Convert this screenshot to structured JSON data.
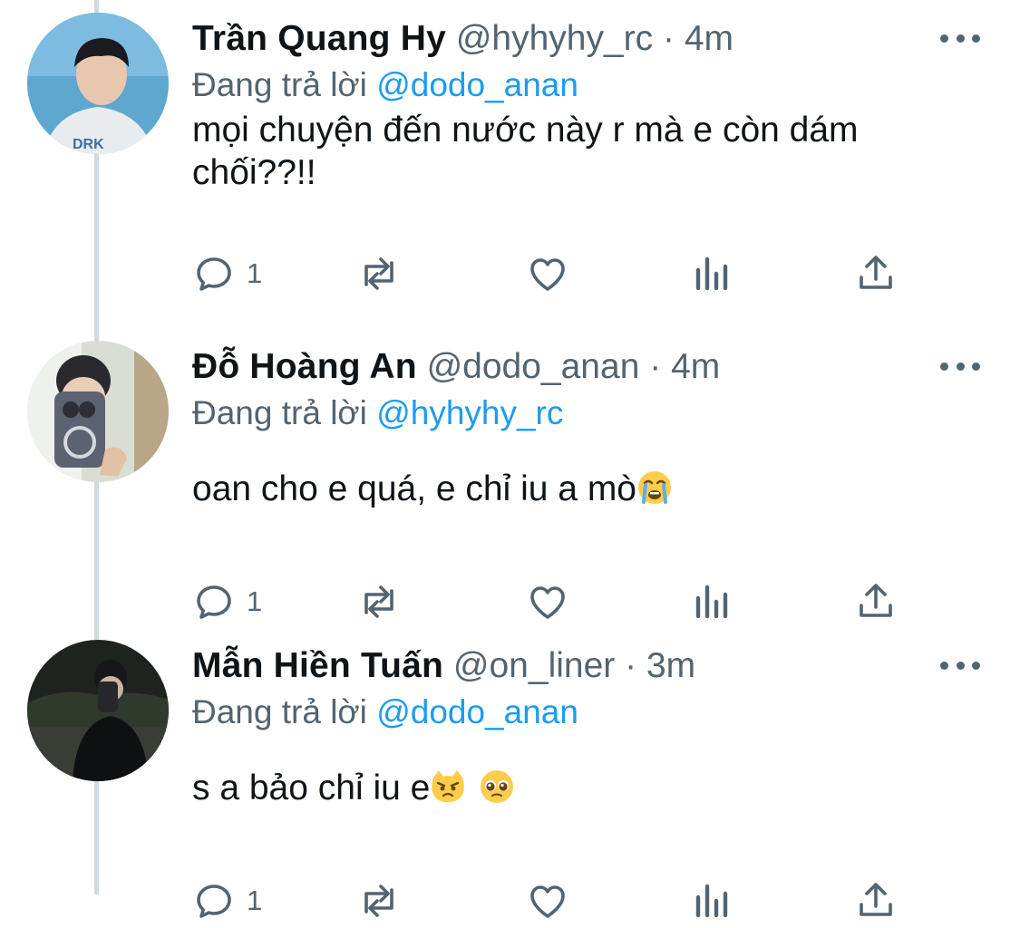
{
  "replies": [
    {
      "name": "Trần Quang Hy",
      "handle": "@hyhyhy_rc",
      "separator": "·",
      "time": "4m",
      "replying_prefix": "Đang trả lời",
      "replying_to": "@dodo_anan",
      "text": "mọi chuyện đến nước này r mà e còn dám chối??!!",
      "emojis": [],
      "reply_count": "1",
      "avatar_icon": "person-photo-avatar"
    },
    {
      "name": "Đỗ Hoàng An",
      "handle": "@dodo_anan",
      "separator": "·",
      "time": "4m",
      "replying_prefix": "Đang trả lời",
      "replying_to": "@hyhyhy_rc",
      "text": "oan cho e quá, e chỉ iu a mò",
      "emojis": [
        "loudly-crying-face"
      ],
      "reply_count": "1",
      "avatar_icon": "mirror-selfie-avatar"
    },
    {
      "name": "Mẫn Hiền Tuấn",
      "handle": "@on_liner",
      "separator": "·",
      "time": "3m",
      "replying_prefix": "Đang trả lời",
      "replying_to": "@dodo_anan",
      "text": "s a bảo chỉ iu e",
      "emojis": [
        "pouting-cat-face",
        "pleading-face"
      ],
      "reply_count": "1",
      "avatar_icon": "night-selfie-avatar"
    }
  ],
  "colors": {
    "link": "#1d9bf0",
    "secondary_text": "#536471",
    "primary_text": "#0f1419",
    "thread_line": "#cfd9de"
  }
}
